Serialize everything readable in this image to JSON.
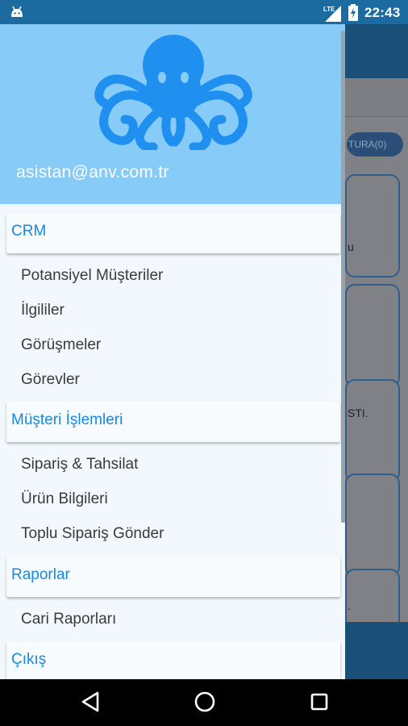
{
  "status_bar": {
    "time": "22:43",
    "network": "LTE"
  },
  "drawer": {
    "account_email": "asistan@anv.com.tr",
    "logo": "octopus-logo",
    "sections": [
      {
        "label": "CRM",
        "items": [
          "Potansiyel Müşteriler",
          "İlgililer",
          "Görüşmeler",
          "Görevler"
        ]
      },
      {
        "label": "Müşteri İşlemleri",
        "items": [
          "Sipariş & Tahsilat",
          "Ürün Bilgileri",
          "Toplu Sipariş Gönder"
        ]
      },
      {
        "label": "Raporlar",
        "items": [
          "Cari Raporları"
        ]
      },
      {
        "label": "Çıkış",
        "items": []
      }
    ]
  },
  "background_app": {
    "pill_text": "TURA(0)",
    "card_fragments": [
      "u",
      "STI.",
      "."
    ]
  },
  "colors": {
    "header": "#87cbf9",
    "accent_blue": "#1a87e0",
    "toolbar": "#1a4f78",
    "statusbar": "#1c6ba0"
  },
  "icons": {
    "nav_back": "back-triangle-icon",
    "nav_home": "home-circle-icon",
    "nav_recents": "recents-square-icon"
  }
}
